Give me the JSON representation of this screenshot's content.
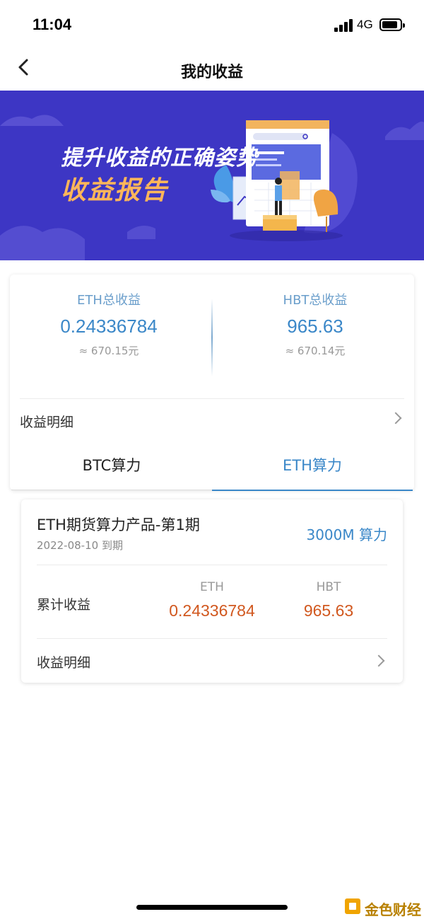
{
  "status_bar": {
    "time": "11:04",
    "network": "4G"
  },
  "nav": {
    "title": "我的收益"
  },
  "banner": {
    "line1": "提升收益的正确姿势",
    "line2": "收益报告"
  },
  "summary": {
    "eth": {
      "label": "ETH总收益",
      "value": "0.24336784",
      "approx": "≈ 670.15元"
    },
    "hbt": {
      "label": "HBT总收益",
      "value": "965.63",
      "approx": "≈ 670.14元"
    },
    "detail_label": "收益明细"
  },
  "tabs": [
    {
      "label": "BTC算力",
      "active": false
    },
    {
      "label": "ETH算力",
      "active": true
    }
  ],
  "product": {
    "name": "ETH期货算力产品-第1期",
    "expiry": "2022-08-10 到期",
    "power": "3000M 算力",
    "cumulative_label": "累计收益",
    "eth_header": "ETH",
    "eth_value": "0.24336784",
    "hbt_header": "HBT",
    "hbt_value": "965.63",
    "detail_label": "收益明细"
  },
  "watermark": {
    "text": "金色财经"
  },
  "colors": {
    "accent": "#3a87c8",
    "earnings": "#d1581f",
    "banner_bg": "#3d36c4",
    "banner_highlight": "#ffb65a"
  }
}
